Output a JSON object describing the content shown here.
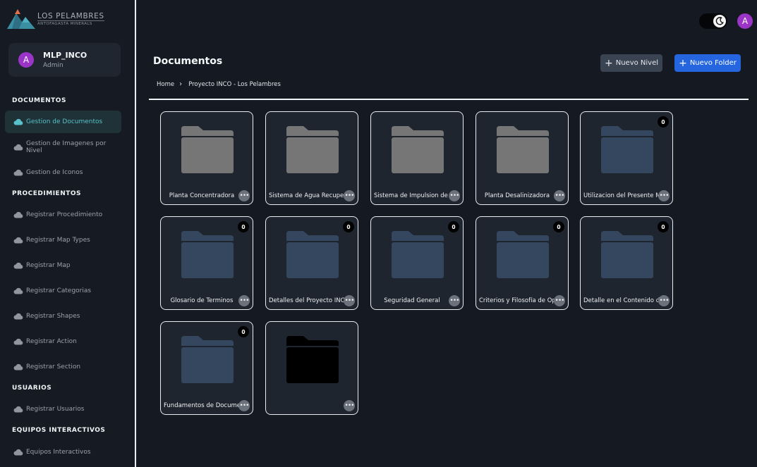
{
  "brand": {
    "title": "LOS PELAMBRES",
    "subtitle": "ANTOFAGASTA MINERALS"
  },
  "user": {
    "initial": "A",
    "name": "MLP_INCO",
    "role": "Admin"
  },
  "sidebar": {
    "documentos_header": "DOCUMENTOS",
    "documentos": [
      "Gestion de Documentos",
      "Gestion de Imagenes por Nivel",
      "Gestion de Iconos"
    ],
    "procedimientos_header": "PROCEDIMIENTOS",
    "procedimientos": [
      "Registrar Procedimiento",
      "Registrar Map Types",
      "Registrar Map",
      "Registrar Categorias",
      "Registrar Shapes",
      "Registrar Action",
      "Registrar Section"
    ],
    "usuarios_header": "USUARIOS",
    "usuarios": [
      "Registrar Usuarios"
    ],
    "equipos_header": "EQUIPOS INTERACTIVOS",
    "equipos": [
      "Equipos Interactivos"
    ]
  },
  "header": {
    "avatar_initial": "A",
    "theme_icon": "moon-icon"
  },
  "main": {
    "title": "Documentos",
    "btn_nuevo_nivel": "Nuevo Nivel",
    "btn_nuevo_folder": "Nuevo Folder",
    "plus_glyph": "+",
    "breadcrumb": [
      "Home",
      "Proyecto INCO - Los Pelambres"
    ],
    "breadcrumb_sep": "›",
    "folders": [
      {
        "label": "Planta Concentradora",
        "badge": null,
        "color": "gray"
      },
      {
        "label": "Sistema de Agua Recuperada",
        "badge": null,
        "color": "gray"
      },
      {
        "label": "Sistema de Impulsion de Agua",
        "badge": null,
        "color": "gray"
      },
      {
        "label": "Planta Desalinizadora",
        "badge": null,
        "color": "gray"
      },
      {
        "label": "Utilizacion del Presente Manual",
        "badge": "0",
        "color": "blue"
      },
      {
        "label": "Glosario de Terminos",
        "badge": "0",
        "color": "blue"
      },
      {
        "label": "Detalles del Proyecto INCO",
        "badge": "0",
        "color": "blue"
      },
      {
        "label": "Seguridad General",
        "badge": "0",
        "color": "blue"
      },
      {
        "label": "Criterios y Filosofía de Operación",
        "badge": "0",
        "color": "blue"
      },
      {
        "label": "Detalle en el Contenido del Manual",
        "badge": "0",
        "color": "blue"
      },
      {
        "label": "Fundamentos de Documentación",
        "badge": "0",
        "color": "blue"
      },
      {
        "label": "",
        "badge": null,
        "color": "black"
      }
    ],
    "menu_glyph": "•••"
  },
  "colors": {
    "folder_gray": "#767676",
    "folder_blue": "#34475f",
    "folder_black": "#000000",
    "accent_blue": "#2566e0",
    "active_teal": "#58c1c9"
  }
}
